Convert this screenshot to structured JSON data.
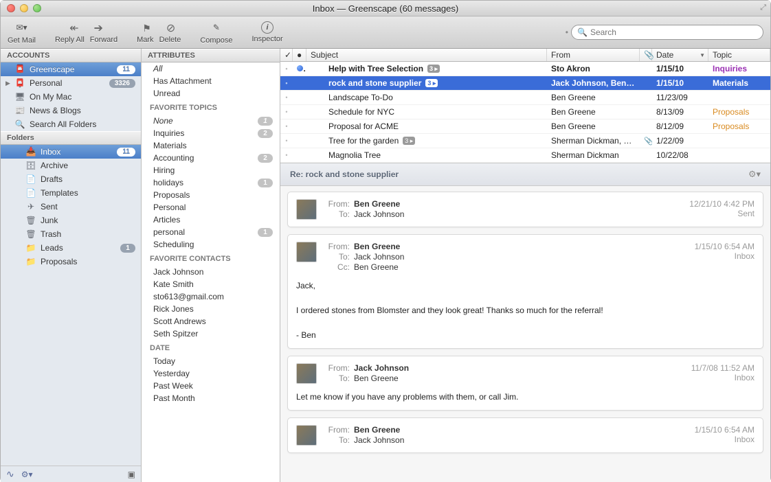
{
  "window": {
    "title": "Inbox — Greenscape (60 messages)"
  },
  "toolbar": {
    "getMail": "Get Mail",
    "replyAll": "Reply All",
    "forward": "Forward",
    "mark": "Mark",
    "delete": "Delete",
    "compose": "Compose",
    "inspector": "Inspector",
    "searchPlaceholder": "Search"
  },
  "sidebar": {
    "accountsHeader": "ACCOUNTS",
    "accounts": [
      {
        "name": "Greenscape",
        "badge": "11",
        "selected": true
      },
      {
        "name": "Personal",
        "badge": "3326",
        "disclosure": true
      },
      {
        "name": "On My Mac"
      },
      {
        "name": "News & Blogs"
      },
      {
        "name": "Search All Folders"
      }
    ],
    "foldersHeader": "Folders",
    "folders": [
      {
        "name": "Inbox",
        "badge": "11",
        "selected": true
      },
      {
        "name": "Archive"
      },
      {
        "name": "Drafts"
      },
      {
        "name": "Templates"
      },
      {
        "name": "Sent"
      },
      {
        "name": "Junk"
      },
      {
        "name": "Trash"
      },
      {
        "name": "Leads",
        "badge": "1"
      },
      {
        "name": "Proposals"
      }
    ]
  },
  "mid": {
    "attributesHeader": "ATTRIBUTES",
    "attributes": [
      {
        "name": "All",
        "ital": true
      },
      {
        "name": "Has Attachment"
      },
      {
        "name": "Unread"
      }
    ],
    "favTopicsHeader": "FAVORITE TOPICS",
    "favTopics": [
      {
        "name": "None",
        "ital": true,
        "badge": "1"
      },
      {
        "name": "Inquiries",
        "badge": "2"
      },
      {
        "name": "Materials"
      },
      {
        "name": "Accounting",
        "badge": "2"
      },
      {
        "name": "Hiring"
      },
      {
        "name": "holidays",
        "badge": "1"
      },
      {
        "name": "Proposals"
      },
      {
        "name": "Personal"
      },
      {
        "name": "Articles"
      },
      {
        "name": "personal",
        "badge": "1"
      },
      {
        "name": "Scheduling"
      }
    ],
    "favContactsHeader": "FAVORITE CONTACTS",
    "favContacts": [
      "Jack Johnson",
      "Kate Smith",
      "sto613@gmail.com",
      "Rick Jones",
      "Scott Andrews",
      "Seth Spitzer"
    ],
    "dateHeader": "DATE",
    "dates": [
      "Today",
      "Yesterday",
      "Past Week",
      "Past Month"
    ]
  },
  "columns": {
    "subject": "Subject",
    "from": "From",
    "date": "Date",
    "topic": "Topic"
  },
  "messages": [
    {
      "subject": "Help with Tree Selection",
      "from": "Sto Akron",
      "date": "1/15/10",
      "topic": "Inquiries",
      "topicClass": "topic-inq",
      "count": "3",
      "unread": true,
      "bold": true
    },
    {
      "subject": "rock and stone supplier",
      "from": "Jack Johnson, Ben Gr…",
      "date": "1/15/10",
      "topic": "Materials",
      "topicClass": "topic-mat",
      "count": "3",
      "selected": true,
      "bold": true
    },
    {
      "subject": "Landscape To-Do",
      "from": "Ben Greene",
      "date": "11/23/09"
    },
    {
      "subject": "Schedule for NYC",
      "from": "Ben Greene",
      "date": "8/13/09",
      "topic": "Proposals",
      "topicClass": "topic-prop"
    },
    {
      "subject": "Proposal for ACME",
      "from": "Ben Greene",
      "date": "8/12/09",
      "topic": "Proposals",
      "topicClass": "topic-prop"
    },
    {
      "subject": "Tree for the garden",
      "from": "Sherman Dickman, B…",
      "date": "1/22/09",
      "count": "3",
      "att": true
    },
    {
      "subject": "Magnolia Tree",
      "from": "Sherman Dickman",
      "date": "10/22/08"
    }
  ],
  "thread": {
    "title": "Re: rock and stone supplier",
    "cards": [
      {
        "from": "Ben Greene",
        "to": "Jack Johnson",
        "meta1": "12/21/10 4:42 PM",
        "meta2": "Sent"
      },
      {
        "from": "Ben Greene",
        "to": "Jack Johnson",
        "cc": "Ben Greene",
        "meta1": "1/15/10 6:54 AM",
        "meta2": "Inbox",
        "body": "Jack,\n\nI ordered stones from Blomster and they look great!  Thanks so much for the referral!\n\n- Ben"
      },
      {
        "from": "Jack Johnson",
        "to": "Ben Greene",
        "meta1": "11/7/08 11:52 AM",
        "meta2": "Inbox",
        "body": "Let me know if you have any problems with them, or call Jim."
      },
      {
        "from": "Ben Greene",
        "to": "Jack Johnson",
        "meta1": "1/15/10 6:54 AM",
        "meta2": "Inbox"
      }
    ]
  }
}
